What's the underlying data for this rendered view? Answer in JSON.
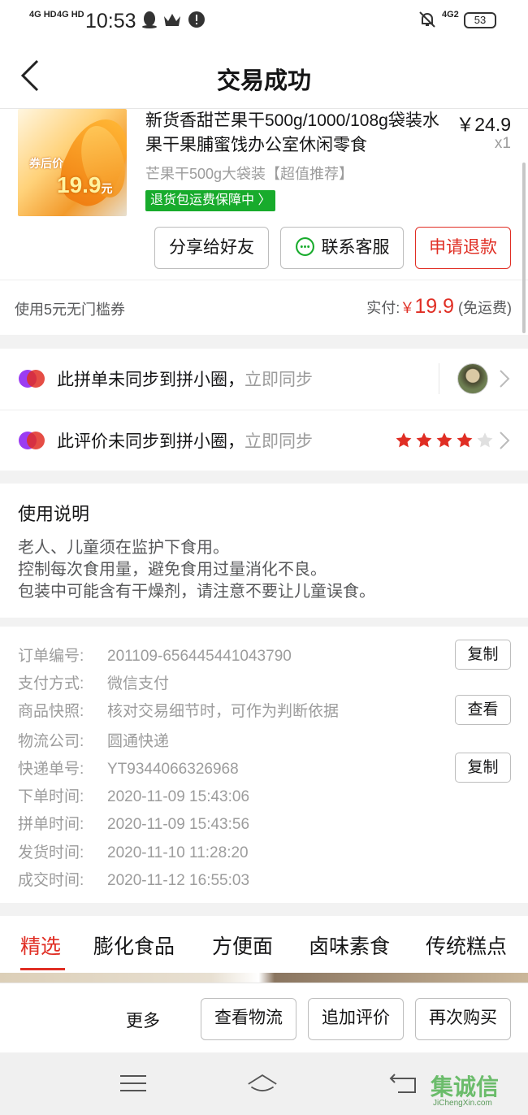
{
  "status_bar": {
    "time": "10:53",
    "signal1": "4G HD",
    "signal2": "4G HD",
    "network": "4G2",
    "battery": "53"
  },
  "navbar": {
    "title": "交易成功"
  },
  "product": {
    "image_tag_label": "券后价",
    "image_tag_price": "19.9",
    "image_tag_unit": "元",
    "title": "新货香甜芒果干500g/1000/108g袋装水果干果脯蜜饯办公室休闲零食",
    "price": "￥24.9",
    "quantity": "x1",
    "spec": "芒果干500g大袋装【超值推荐】",
    "badge": "退货包运费保障中",
    "buttons": {
      "share": "分享给好友",
      "contact": "联系客服",
      "refund": "申请退款"
    },
    "coupon": "使用5元无门槛券",
    "paid_label": "实付:",
    "paid_currency": "￥",
    "paid_amount": "19.9",
    "paid_note": "(免运费)"
  },
  "sync": {
    "row1_text": "此拼单未同步到拼小圈，",
    "row1_action": "立即同步",
    "row2_text": "此评价未同步到拼小圈，",
    "row2_action": "立即同步",
    "rating": 4,
    "rating_max": 5
  },
  "usage": {
    "title": "使用说明",
    "lines": [
      "老人、儿童须在监护下食用。",
      "控制每次食用量，避免食用过量消化不良。",
      "包装中可能含有干燥剂，请注意不要让儿童误食。"
    ]
  },
  "order_info": {
    "rows": [
      {
        "label": "订单编号:",
        "value": "201109-656445441043790",
        "button": "复制"
      },
      {
        "label": "支付方式:",
        "value": "微信支付"
      },
      {
        "label": "商品快照:",
        "value": "核对交易细节时，可作为判断依据",
        "button": "查看"
      },
      {
        "label": "物流公司:",
        "value": "圆通快递"
      },
      {
        "label": "快递单号:",
        "value": "YT9344066326968",
        "button": "复制"
      },
      {
        "label": "下单时间:",
        "value": "2020-11-09 15:43:06"
      },
      {
        "label": "拼单时间:",
        "value": "2020-11-09 15:43:56"
      },
      {
        "label": "发货时间:",
        "value": "2020-11-10 11:28:20"
      },
      {
        "label": "成交时间:",
        "value": "2020-11-12 16:55:03"
      }
    ]
  },
  "tabs": [
    "精选",
    "膨化食品",
    "方便面",
    "卤味素食",
    "传统糕点"
  ],
  "actions": {
    "more": "更多",
    "logistics": "查看物流",
    "review": "追加评价",
    "rebuy": "再次购买"
  },
  "watermark": {
    "main": "集诚信",
    "sub": "JiChengXin.com"
  },
  "colors": {
    "accent": "#e02e24",
    "badge_green": "#18ab2c",
    "star_red": "#e02e24",
    "star_empty": "#e0e0e0"
  }
}
